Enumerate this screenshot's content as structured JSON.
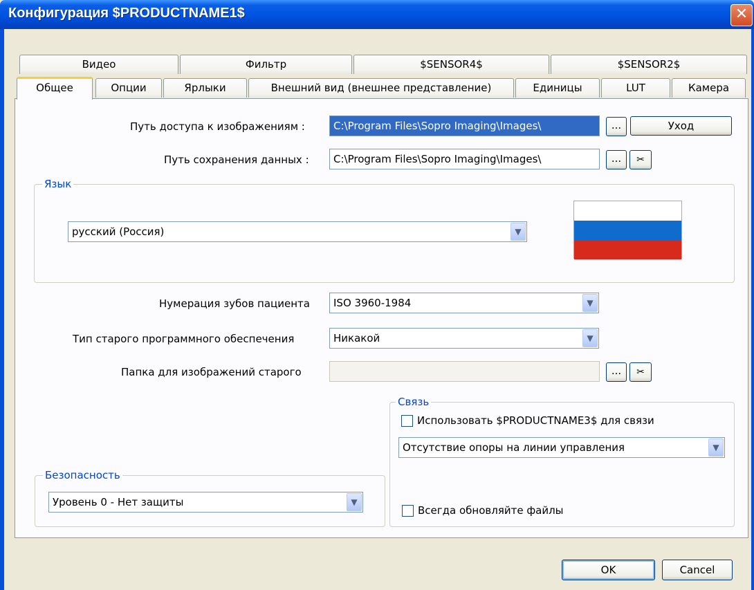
{
  "window": {
    "title": "Конфигурация $PRODUCTNAME1$",
    "close_glyph": "✕"
  },
  "tabs_back": [
    "Видео",
    "Фильтр",
    "$SENSOR4$",
    "$SENSOR2$"
  ],
  "tabs_front": [
    "Общее",
    "Опции",
    "Ярлыки",
    "Внешний вид (внешнее представление)",
    "Единицы",
    "LUT",
    "Камера"
  ],
  "general": {
    "image_path_label": "Путь доступа к изображениям :",
    "image_path_value": "C:\\Program Files\\Sopro Imaging\\Images\\",
    "browse_label": "...",
    "exit_label": "Уход",
    "data_path_label": "Путь сохранения данных :",
    "data_path_value": "C:\\Program Files\\Sopro Imaging\\Images\\",
    "scissors_glyph": "✂"
  },
  "language": {
    "group_label": "Язык",
    "selected": "русский (Россия)",
    "flag_colors": [
      "#ffffff",
      "#0f6ccc",
      "#d72a1c"
    ]
  },
  "tooth_numbering": {
    "label": "Нумерация зубов пациента",
    "selected": "ISO 3960-1984"
  },
  "old_software": {
    "label": "Тип старого программного обеспечения",
    "selected": "Никакой"
  },
  "old_folder": {
    "label": "Папка для изображений старого",
    "value": ""
  },
  "link": {
    "group_label": "Связь",
    "use_checkbox_label": "Использовать $PRODUCTNAME3$ для связи",
    "use_checked": false,
    "mode_selected": "Отсутствие опоры на линии управления",
    "always_update_label": "Всегда обновляйте файлы",
    "always_update_checked": false
  },
  "security": {
    "group_label": "Безопасность",
    "selected": "Уровень 0 - Нет защиты"
  },
  "footer": {
    "ok_label": "OK",
    "cancel_label": "Cancel"
  },
  "dropdown_glyph": "▼"
}
